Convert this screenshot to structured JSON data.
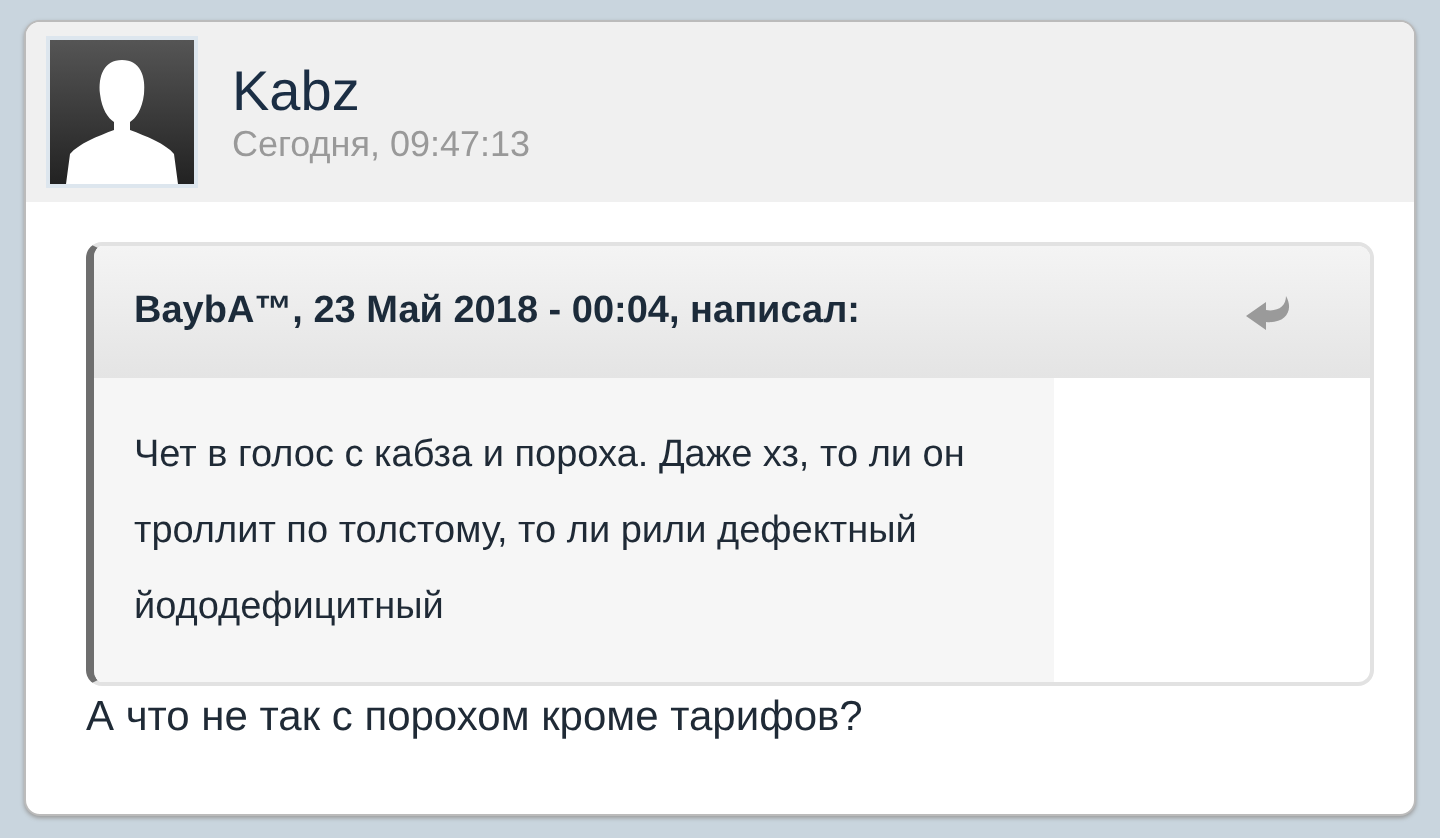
{
  "post": {
    "author": "Kabz",
    "time": "Сегодня, 09:47:13",
    "quote": {
      "citation": "BaybA™, 23 Май 2018 - 00:04, написал:",
      "text": "Чет в голос с кабза и пороха. Даже хз, то ли он троллит по толстому, то ли рили дефектный йододефицитный"
    },
    "text": "А что не так с порохом кроме тарифов?"
  }
}
